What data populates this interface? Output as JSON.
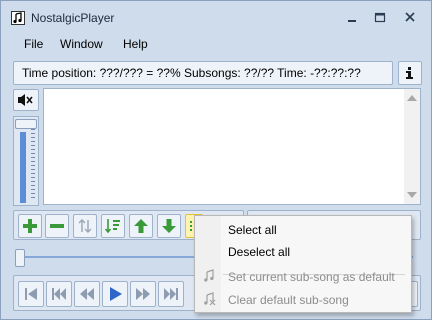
{
  "window": {
    "title": "NostalgicPlayer"
  },
  "menu": {
    "file": "File",
    "window": "Window",
    "help": "Help"
  },
  "status": {
    "text": "Time position: ???/??? = ??% Subsongs: ??/?? Time: -??:??:??"
  },
  "volume": {
    "level": 0.85
  },
  "position": {
    "level": 0.0
  },
  "context_menu": {
    "select_all": "Select all",
    "deselect_all": "Deselect all",
    "set_default": "Set current sub-song as default",
    "clear_default": "Clear default sub-song"
  },
  "colors": {
    "window_bg": "#cfdcec",
    "green": "#3a9a3a",
    "play_blue": "#2f64c8",
    "highlight": "#fff3b0"
  }
}
